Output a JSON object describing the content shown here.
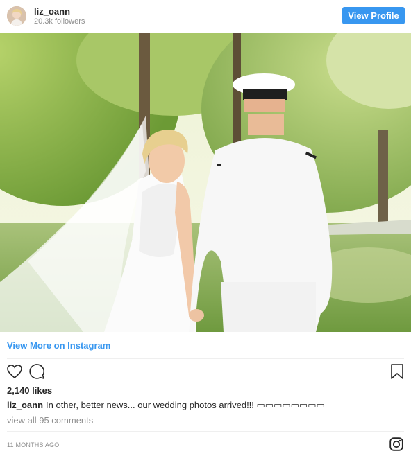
{
  "header": {
    "username": "liz_oann",
    "followers": "20.3k followers",
    "view_profile_label": "View Profile"
  },
  "post": {
    "image_alt": "Bride in lace wedding dress and veil holding hands with groom in white naval dress uniform among green trees",
    "view_more_label": "View More on Instagram",
    "likes": "2,140 likes",
    "caption_user": "liz_oann",
    "caption_text": "In other, better news... our wedding photos arrived!!! ▭▭▭▭▭▭▭▭",
    "comments_link": "view all 95 comments",
    "timestamp": "11 MONTHS AGO"
  },
  "icons": {
    "like": "heart-icon",
    "comment": "comment-bubble-icon",
    "save": "bookmark-icon",
    "brand": "instagram-icon"
  },
  "colors": {
    "accent": "#3897f0",
    "text": "#262626",
    "muted": "#8e8e8e",
    "divider": "#efefef"
  }
}
